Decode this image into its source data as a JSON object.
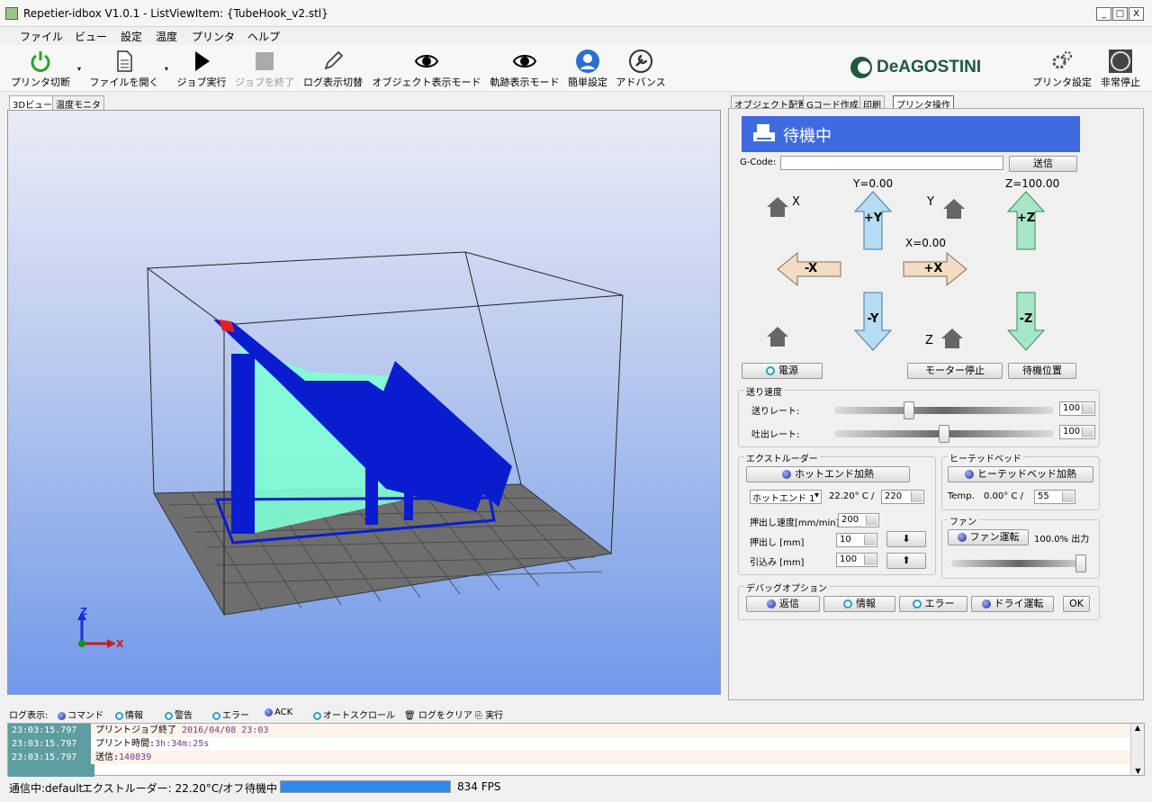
{
  "window": {
    "title": "Repetier-idbox V1.0.1 - ListViewItem: {TubeHook_v2.stl}",
    "min": "_",
    "max": "□",
    "close": "X"
  },
  "menu": [
    "ファイル",
    "ビュー",
    "設定",
    "温度",
    "プリンタ",
    "ヘルプ"
  ],
  "toolbar": {
    "disconnect": "プリンタ切断",
    "open_file": "ファイルを開く",
    "run_job": "ジョブ実行",
    "stop_job": "ジョブを終了",
    "log_toggle": "ログ表示切替",
    "object_mode": "オブジェクト表示モード",
    "path_mode": "軌跡表示モード",
    "easy_settings": "簡単設定",
    "advance": "アドバンス",
    "brand": "DeAGOSTINI",
    "printer_settings": "プリンタ設定",
    "emergency_stop": "非常停止"
  },
  "left_tabs": [
    "3Dビュー",
    "温度モニタ"
  ],
  "axis": {
    "x": "X",
    "z": "Z"
  },
  "right_tabs": [
    "オブジェクト配置",
    "Gコード作成",
    "印刷",
    "プリンタ操作"
  ],
  "status_banner": "待機中",
  "gcode": {
    "label": "G-Code:",
    "value": "",
    "send": "送信"
  },
  "jog": {
    "y_readout": "Y=0.00",
    "z_readout": "Z=100.00",
    "x_readout": "X=0.00",
    "home_x": "X",
    "home_y": "Y",
    "home_z": "Z",
    "plus_y": "+Y",
    "minus_y": "-Y",
    "plus_x": "+X",
    "minus_x": "-X",
    "plus_z": "+Z",
    "minus_z": "-Z"
  },
  "power": "電源",
  "motor_stop": "モーター停止",
  "park": "待機位置",
  "feed": {
    "title": "送り速度",
    "feed_rate": "送りレート:",
    "flow_rate": "吐出レート:",
    "feed_val": "100",
    "flow_val": "100",
    "feed_level": 0.33,
    "flow_level": 0.5
  },
  "extruder": {
    "title": "エクストルーダー",
    "heat": "ホットエンド加熱",
    "select": "ホットエンド 1",
    "temp": "22.20° C /",
    "target": "220",
    "speed_label": "押出し速度[mm/min]",
    "speed": "200",
    "extrude_label": "押出し [mm]",
    "extrude": "10",
    "retract_label": "引込み [mm]",
    "retract": "100"
  },
  "bed": {
    "title": "ヒーテッドベッド",
    "heat": "ヒーテッドベッド加熱",
    "temp_label": "Temp.",
    "temp": "0.00° C /",
    "target": "55"
  },
  "fan": {
    "title": "ファン",
    "run": "ファン運転",
    "output": "100.0% 出力",
    "level": 1.0
  },
  "debug": {
    "title": "デバッグオプション",
    "echo": "返信",
    "info": "情報",
    "error": "エラー",
    "dry_run": "ドライ運転",
    "ok": "OK"
  },
  "logbar": {
    "label": "ログ表示:",
    "commands": "コマンド",
    "info": "情報",
    "warning": "警告",
    "error": "エラー",
    "ack": "ACK",
    "autoscroll": "オートスクロール",
    "clear": "ログをクリア",
    "run": "実行"
  },
  "log": [
    {
      "ts": "23:03:15.797",
      "msg": "プリントジョブ終了",
      "val": "2016/04/08 23:03"
    },
    {
      "ts": "23:03:15.797",
      "msg": "プリント時間:",
      "val": "3h:34m:25s"
    },
    {
      "ts": "23:03:15.797",
      "msg": "送信:",
      "val": "140839"
    }
  ],
  "statusbar": {
    "conn": "通信中:default",
    "extruder": "エクストルーダー: 22.20°C/オフ",
    "state": "待機中",
    "progress": 1.0,
    "fps": "834 FPS"
  }
}
